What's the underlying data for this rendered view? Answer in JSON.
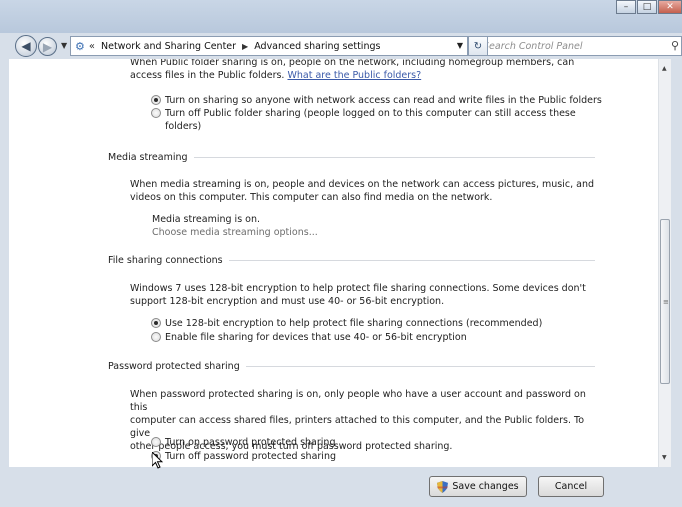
{
  "navigation": {
    "back_icon": "back-arrow-icon",
    "forward_icon": "forward-arrow-icon",
    "breadcrumb_overflow": "«",
    "breadcrumbs": [
      "Network and Sharing Center",
      "Advanced sharing settings"
    ],
    "search_placeholder": "Search Control Panel"
  },
  "public_folder": {
    "intro_line1": "When Public folder sharing is on, people on the network, including homegroup members, can",
    "intro_line2": "access files in the Public folders.",
    "link": "What are the Public folders?",
    "options": [
      {
        "label": "Turn on sharing so anyone with network access can read and write files in the Public folders",
        "checked": true
      },
      {
        "label_line1": "Turn off Public folder sharing (people logged on to this computer can still access these",
        "label_line2": "folders)",
        "checked": false
      }
    ]
  },
  "media_streaming": {
    "title": "Media streaming",
    "desc_line1": "When media streaming is on, people and devices on the network can access pictures, music, and",
    "desc_line2": "videos on this computer. This computer can also find media on the network.",
    "status": "Media streaming is on.",
    "options_link": "Choose media streaming options..."
  },
  "file_sharing": {
    "title": "File sharing connections",
    "desc_line1": "Windows 7 uses 128-bit encryption to help protect file sharing connections. Some devices don't",
    "desc_line2": "support 128-bit encryption and must use 40- or 56-bit encryption.",
    "options": [
      {
        "label": "Use 128-bit encryption to help protect file sharing connections (recommended)",
        "checked": true
      },
      {
        "label": "Enable file sharing for devices that use 40- or 56-bit encryption",
        "checked": false
      }
    ]
  },
  "password_sharing": {
    "title": "Password protected sharing",
    "desc_line1": "When password protected sharing is on, only people who have a user account and password on this",
    "desc_line2": "computer can access shared files, printers attached to this computer, and the Public folders. To give",
    "desc_line3": "other people access, you must turn off password protected sharing.",
    "options": [
      {
        "label": "Turn on password protected sharing",
        "checked": false
      },
      {
        "label": "Turn off password protected sharing",
        "checked": true
      }
    ]
  },
  "footer": {
    "save_label": "Save changes",
    "cancel_label": "Cancel"
  }
}
